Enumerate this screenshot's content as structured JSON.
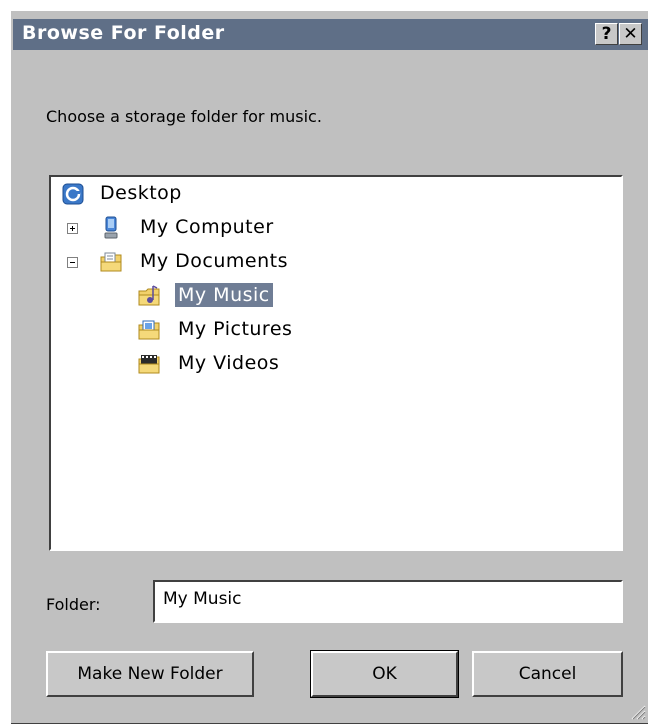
{
  "window": {
    "title": "Browse For Folder",
    "help_glyph": "?",
    "close_glyph": "✕"
  },
  "prompt": "Choose a storage folder for music.",
  "tree": {
    "items": [
      {
        "label": "Desktop",
        "icon": "desktop-icon",
        "expander": "none"
      },
      {
        "label": "My Computer",
        "icon": "computer-icon",
        "expander": "plus"
      },
      {
        "label": "My Documents",
        "icon": "documents-folder-icon",
        "expander": "minus"
      },
      {
        "label": "My Music",
        "icon": "music-folder-icon",
        "expander": "none",
        "selected": true
      },
      {
        "label": "My Pictures",
        "icon": "pictures-folder-icon",
        "expander": "none"
      },
      {
        "label": "My Videos",
        "icon": "videos-folder-icon",
        "expander": "none"
      }
    ]
  },
  "folder": {
    "label": "Folder:",
    "value": "My Music"
  },
  "buttons": {
    "make_new_folder": "Make New Folder",
    "ok": "OK",
    "cancel": "Cancel"
  },
  "colors": {
    "titlebar": "#5f6f87",
    "selection": "#6f7d95",
    "face": "#c0c0c0"
  }
}
